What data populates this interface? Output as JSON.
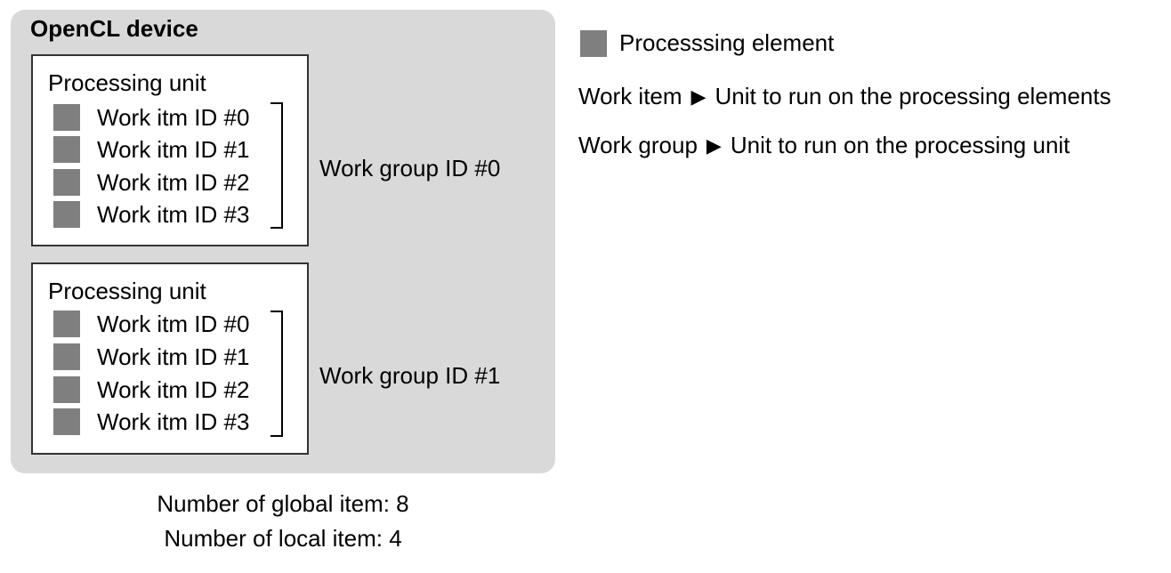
{
  "device": {
    "title": "OpenCL device"
  },
  "units": [
    {
      "label": "Processing unit",
      "items": [
        "Work itm ID #0",
        "Work itm ID #1",
        "Work itm ID #2",
        "Work itm ID #3"
      ],
      "group": "Work group ID #0"
    },
    {
      "label": "Processing unit",
      "items": [
        "Work itm ID #0",
        "Work itm ID #1",
        "Work itm ID #2",
        "Work itm ID #3"
      ],
      "group": "Work group ID #1"
    }
  ],
  "legend": {
    "processing_element": "Processsing element",
    "work_item_term": "Work item",
    "work_item_desc": "Unit to run on the processing elements",
    "work_group_term": "Work group",
    "work_group_desc": "Unit to run on the processing unit",
    "arrow_glyph": "▶"
  },
  "counts": {
    "global": "Number of global item: 8",
    "local": "Number of local item: 4"
  },
  "colors": {
    "device_bg": "#d9d9d9",
    "processing_element": "#7f7f7f"
  }
}
